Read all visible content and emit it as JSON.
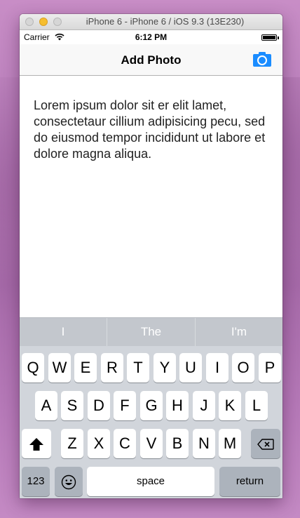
{
  "window": {
    "title": "iPhone 6 - iPhone 6 / iOS 9.3 (13E230)"
  },
  "status_bar": {
    "carrier": "Carrier",
    "time": "6:12 PM",
    "icons": [
      "wifi-icon",
      "battery-icon"
    ]
  },
  "nav": {
    "title": "Add Photo",
    "right_icon": "camera-icon",
    "accent": "#1a8cff"
  },
  "content": {
    "text": "Lorem ipsum dolor sit er elit lamet, consectetaur cillium adipisicing pecu, sed do eiusmod tempor incididunt ut labore et dolore magna aliqua."
  },
  "keyboard": {
    "suggestions": [
      "I",
      "The",
      "I'm"
    ],
    "row1": [
      "Q",
      "W",
      "E",
      "R",
      "T",
      "Y",
      "U",
      "I",
      "O",
      "P"
    ],
    "row2": [
      "A",
      "S",
      "D",
      "F",
      "G",
      "H",
      "J",
      "K",
      "L"
    ],
    "row3": [
      "Z",
      "X",
      "C",
      "V",
      "B",
      "N",
      "M"
    ],
    "numbers_label": "123",
    "space_label": "space",
    "return_label": "return",
    "icons": [
      "shift-icon",
      "backspace-icon",
      "emoji-icon"
    ]
  }
}
